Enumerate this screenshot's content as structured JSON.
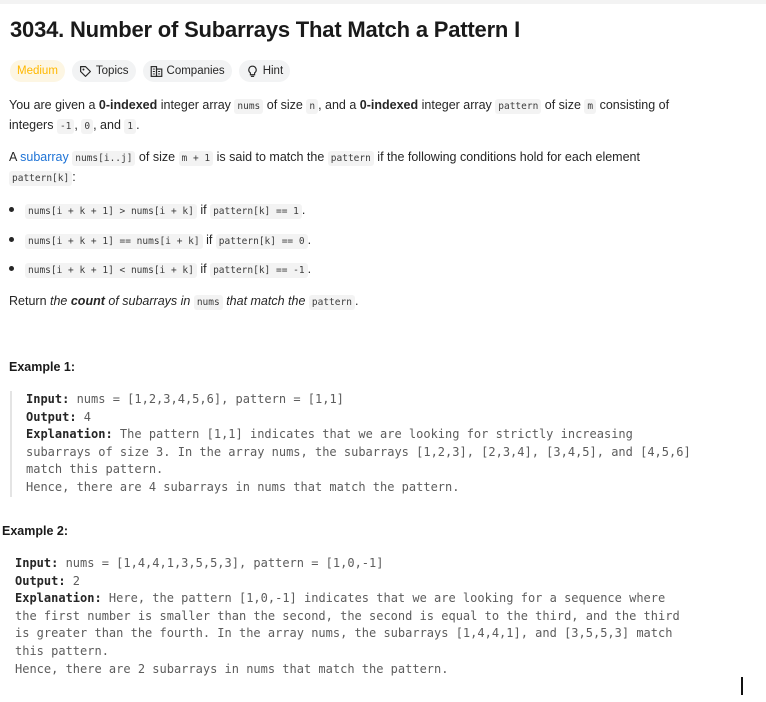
{
  "problem": {
    "title": "3034. Number of Subarrays That Match a Pattern I",
    "difficulty": "Medium",
    "tags": [
      {
        "label": "Topics",
        "icon": "tag-icon"
      },
      {
        "label": "Companies",
        "icon": "building-icon"
      },
      {
        "label": "Hint",
        "icon": "lightbulb-icon"
      }
    ]
  },
  "description": {
    "p1": {
      "t1": "You are given a ",
      "b1": "0-indexed",
      "t2": " integer array ",
      "c1": "nums",
      "t3": " of size ",
      "c2": "n",
      "t4": ", and a ",
      "b2": "0-indexed",
      "t5": " integer array ",
      "c3": "pattern",
      "t6": " of size ",
      "c4": "m",
      "t7": " consisting of",
      "t8": "integers ",
      "c5": "-1",
      "t9": ", ",
      "c6": "0",
      "t10": ", and ",
      "c7": "1",
      "t11": "."
    },
    "p2": {
      "t1": "A ",
      "link": "subarray",
      "t2": " ",
      "c1": "nums[i..j]",
      "t3": " of size ",
      "c2": "m + 1",
      "t4": " is said to match the ",
      "c3": "pattern",
      "t5": " if the following conditions hold for each element",
      "c4": "pattern[k]",
      "t6": ":"
    },
    "bullets": [
      {
        "c1": "nums[i + k + 1] > nums[i + k]",
        "t1": " if ",
        "c2": "pattern[k] == 1",
        "t2": "."
      },
      {
        "c1": "nums[i + k + 1] == nums[i + k]",
        "t1": " if ",
        "c2": "pattern[k] == 0",
        "t2": "."
      },
      {
        "c1": "nums[i + k + 1] < nums[i + k]",
        "t1": " if ",
        "c2": "pattern[k] == -1",
        "t2": "."
      }
    ],
    "p3": {
      "t1": "Return ",
      "i1": "the ",
      "b1": "count",
      "i2": " of subarrays in ",
      "c1": "nums",
      "i3": " that match the ",
      "c2": "pattern",
      "t2": "."
    }
  },
  "examples": [
    {
      "heading": "Example 1:",
      "input_label": "Input:",
      "input": " nums = [1,2,3,4,5,6], pattern = [1,1]",
      "output_label": "Output:",
      "output": " 4",
      "explanation_label": "Explanation:",
      "explanation_lines": [
        " The pattern [1,1] indicates that we are looking for strictly increasing",
        "subarrays of size 3. In the array nums, the subarrays [1,2,3], [2,3,4], [3,4,5], and [4,5,6]",
        "match this pattern.",
        "Hence, there are 4 subarrays in nums that match the pattern."
      ]
    },
    {
      "heading": "Example 2:",
      "input_label": "Input:",
      "input": " nums = [1,4,4,1,3,5,5,3], pattern = [1,0,-1]",
      "output_label": "Output:",
      "output": " 2",
      "explanation_label": "Explanation:",
      "explanation_lines": [
        " Here, the pattern [1,0,-1] indicates that we are looking for a sequence where",
        "the first number is smaller than the second, the second is equal to the third, and the third",
        "is greater than the fourth. In the array nums, the subarrays [1,4,4,1], and [3,5,5,3] match",
        "this pattern.",
        "Hence, there are 2 subarrays in nums that match the pattern."
      ]
    }
  ],
  "colors": {
    "difficulty_medium": "#ffb800",
    "link": "#1e73d6",
    "text": "#262626",
    "code_bg": "#f3f3f3"
  }
}
